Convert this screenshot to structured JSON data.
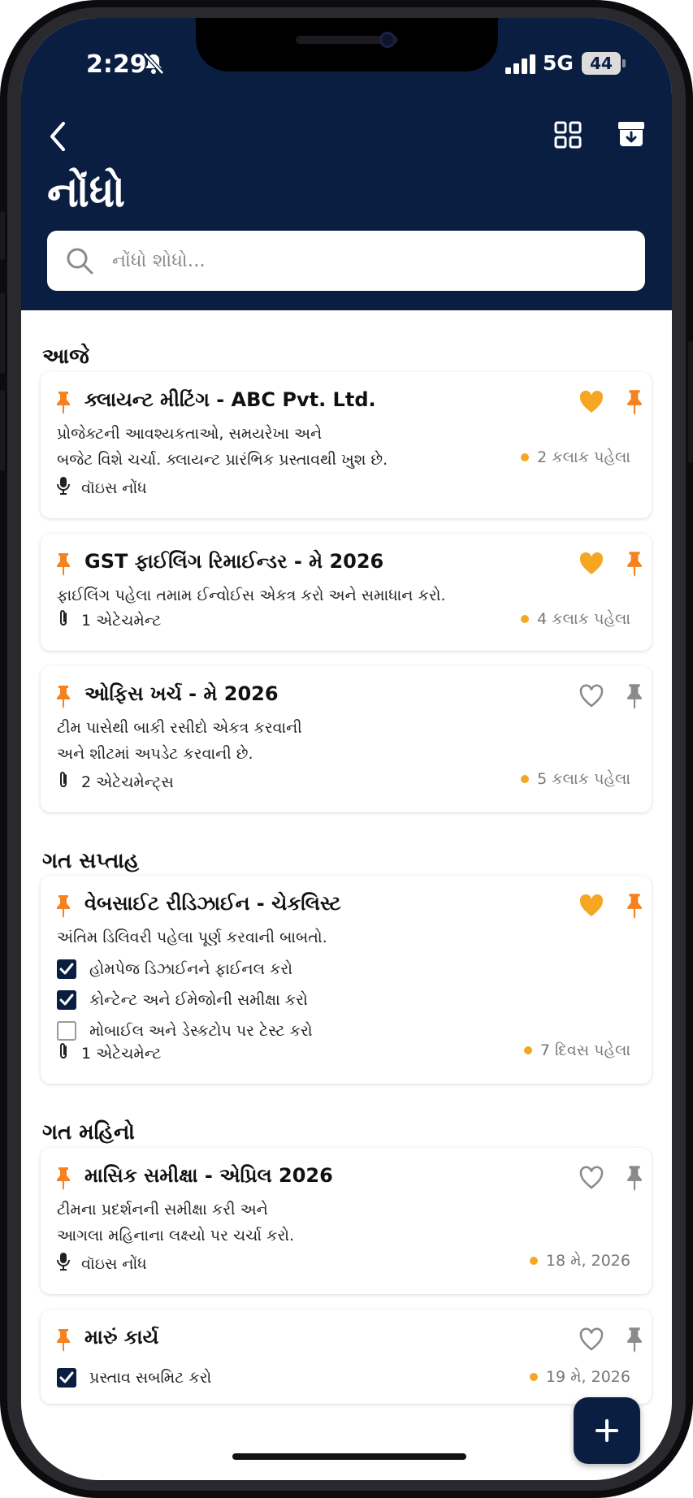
{
  "status": {
    "time": "2:29",
    "network": "5G",
    "battery": "44"
  },
  "header": {
    "title": "નોંધો"
  },
  "search": {
    "placeholder": "નોંધો શોધો..."
  },
  "colors": {
    "header_bg": "#0a1e42",
    "accent_orange": "#f5821f",
    "heart_yellow": "#f5a623",
    "muted_gray": "#8a8a8a"
  },
  "sections": [
    {
      "title": "આજે",
      "notes": [
        {
          "title": "ક્લાયન્ટ મીટિંગ - ABC Pvt. Ltd.",
          "favorite": true,
          "pinned": true,
          "desc": [
            "પ્રોજેક્ટની આવશ્યકતાઓ, સમયરેખા અને",
            "બજેટ વિશે ચર્ચા. ક્લાયન્ટ પ્રારંભિક પ્રસ્તાવથી ખુશ છે."
          ],
          "meta_icon": "mic-icon",
          "meta": "વૉઇસ નોંધ",
          "time": "2 કલાક પહેલા"
        },
        {
          "title": "GST ફાઈલિંગ રિમાઈન્ડર - મે 2026",
          "favorite": true,
          "pinned": true,
          "desc": [
            "ફાઈલિંગ પહેલા તમામ ઈન્વોઈસ એકત્ર કરો અને સમાધાન કરો."
          ],
          "meta_icon": "paperclip-icon",
          "meta": "1 એટેચમેન્ટ",
          "time": "4 કલાક પહેલા"
        },
        {
          "title": "ઓફિસ ખર્ચ - મે 2026",
          "favorite": false,
          "pinned": false,
          "desc": [
            "ટીમ પાસેથી બાકી રસીદો એકત્ર કરવાની",
            "અને શીટમાં અપડેટ કરવાની છે."
          ],
          "meta_icon": "paperclip-icon",
          "meta": "2 એટેચમેન્ટ્સ",
          "time": "5 કલાક પહેલા"
        }
      ]
    },
    {
      "title": "ગત સપ્તાહ",
      "notes": [
        {
          "title": "વેબસાઈટ રીડિઝાઈન - ચેકલિસ્ટ",
          "favorite": true,
          "pinned": true,
          "desc": [
            "અંતિમ ડિલિવરી પહેલા પૂર્ણ કરવાની બાબતો."
          ],
          "checklist": [
            {
              "text": "હોમપેજ ડિઝાઈનને ફાઈનલ કરો",
              "checked": true
            },
            {
              "text": "કોન્ટેન્ટ અને ઈમેજોની સમીક્ષા કરો",
              "checked": true
            },
            {
              "text": "મોબાઈલ અને ડેસ્કટોપ પર ટેસ્ટ કરો",
              "checked": false
            }
          ],
          "meta_icon": "paperclip-icon",
          "meta": "1 એટેચમેન્ટ",
          "time": "7 દિવસ પહેલા"
        }
      ]
    },
    {
      "title": "ગત મહિનો",
      "notes": [
        {
          "title": "માસિક સમીક્ષા - એપ્રિલ 2026",
          "favorite": false,
          "pinned": false,
          "desc": [
            "ટીમના પ્રદર્શનની સમીક્ષા કરી અને",
            "આગલા મહિનાના લક્ષ્યો પર ચર્ચા કરો."
          ],
          "meta_icon": "mic-icon",
          "meta": "વૉઇસ નોંધ",
          "time": "18 મે, 2026"
        },
        {
          "title": "મારું કાર્ય",
          "favorite": false,
          "pinned": false,
          "checklist": [
            {
              "text": "પ્રસ્તાવ સબમિટ કરો",
              "checked": true
            }
          ],
          "time": "19 મે, 2026"
        }
      ]
    }
  ]
}
